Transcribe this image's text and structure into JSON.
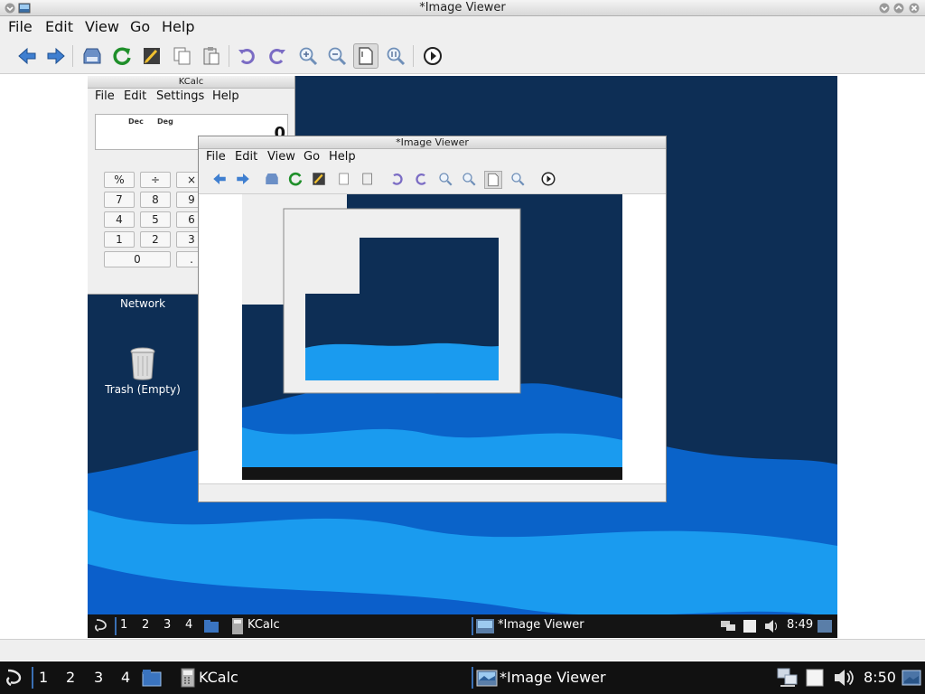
{
  "window": {
    "title": "*Image Viewer"
  },
  "menu": [
    "File",
    "Edit",
    "View",
    "Go",
    "Help"
  ],
  "screenshot": {
    "kcalc": {
      "title": "KCalc",
      "menu": [
        "File",
        "Edit",
        "Settings",
        "Help"
      ],
      "mode_dec": "Dec",
      "mode_deg": "Deg",
      "display": "0",
      "keys": [
        "%",
        "÷",
        "×",
        "7",
        "8",
        "9",
        "4",
        "5",
        "6",
        "1",
        "2",
        "3",
        "0",
        "."
      ]
    },
    "desktop_network": "Network",
    "desktop_trash": "Trash (Empty)",
    "inner_viewer": {
      "title": "*Image Viewer",
      "menu": [
        "File",
        "Edit",
        "View",
        "Go",
        "Help"
      ]
    },
    "inner_taskbar": {
      "desktops": [
        "1",
        "2",
        "3",
        "4"
      ],
      "kcalc": "KCalc",
      "viewer": "*Image Viewer",
      "clock": "8:49"
    }
  },
  "taskbar": {
    "desktops": [
      "1",
      "2",
      "3",
      "4"
    ],
    "kcalc": "KCalc",
    "viewer": "*Image Viewer",
    "clock": "8:50"
  },
  "colors": {
    "desktop_bg": "#0d2e55",
    "wave_light": "#1aa0f0",
    "wave_dark": "#0a63c9",
    "taskbar": "#111111"
  }
}
